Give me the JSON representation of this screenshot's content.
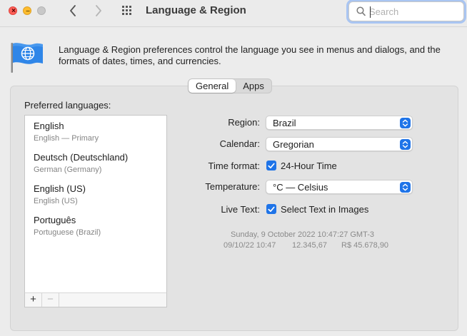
{
  "window": {
    "title": "Language & Region",
    "search_placeholder": "Search"
  },
  "header": {
    "description": "Language & Region preferences control the language you see in menus and dialogs, and the formats of dates, times, and currencies."
  },
  "tabs": [
    {
      "label": "General",
      "active": true
    },
    {
      "label": "Apps",
      "active": false
    }
  ],
  "languages": {
    "label": "Preferred languages:",
    "items": [
      {
        "name": "English",
        "sub": "English — Primary"
      },
      {
        "name": "Deutsch (Deutschland)",
        "sub": "German (Germany)"
      },
      {
        "name": "English (US)",
        "sub": "English (US)"
      },
      {
        "name": "Português",
        "sub": "Portuguese (Brazil)"
      }
    ],
    "add_label": "+",
    "remove_label": "−"
  },
  "settings": {
    "region": {
      "label": "Region:",
      "value": "Brazil"
    },
    "calendar": {
      "label": "Calendar:",
      "value": "Gregorian"
    },
    "time_format": {
      "label": "Time format:",
      "value": "24-Hour Time",
      "checked": true
    },
    "temperature": {
      "label": "Temperature:",
      "value": "°C — Celsius"
    },
    "live_text": {
      "label": "Live Text:",
      "value": "Select Text in Images",
      "checked": true
    }
  },
  "sample": {
    "long_date": "Sunday, 9 October 2022 10:47:27 GMT-3",
    "short_date": "09/10/22 10:47",
    "number": "12.345,67",
    "currency": "R$ 45.678,90"
  },
  "colors": {
    "accent": "#1f74e8",
    "focus_ring": "#a9c5f2"
  }
}
